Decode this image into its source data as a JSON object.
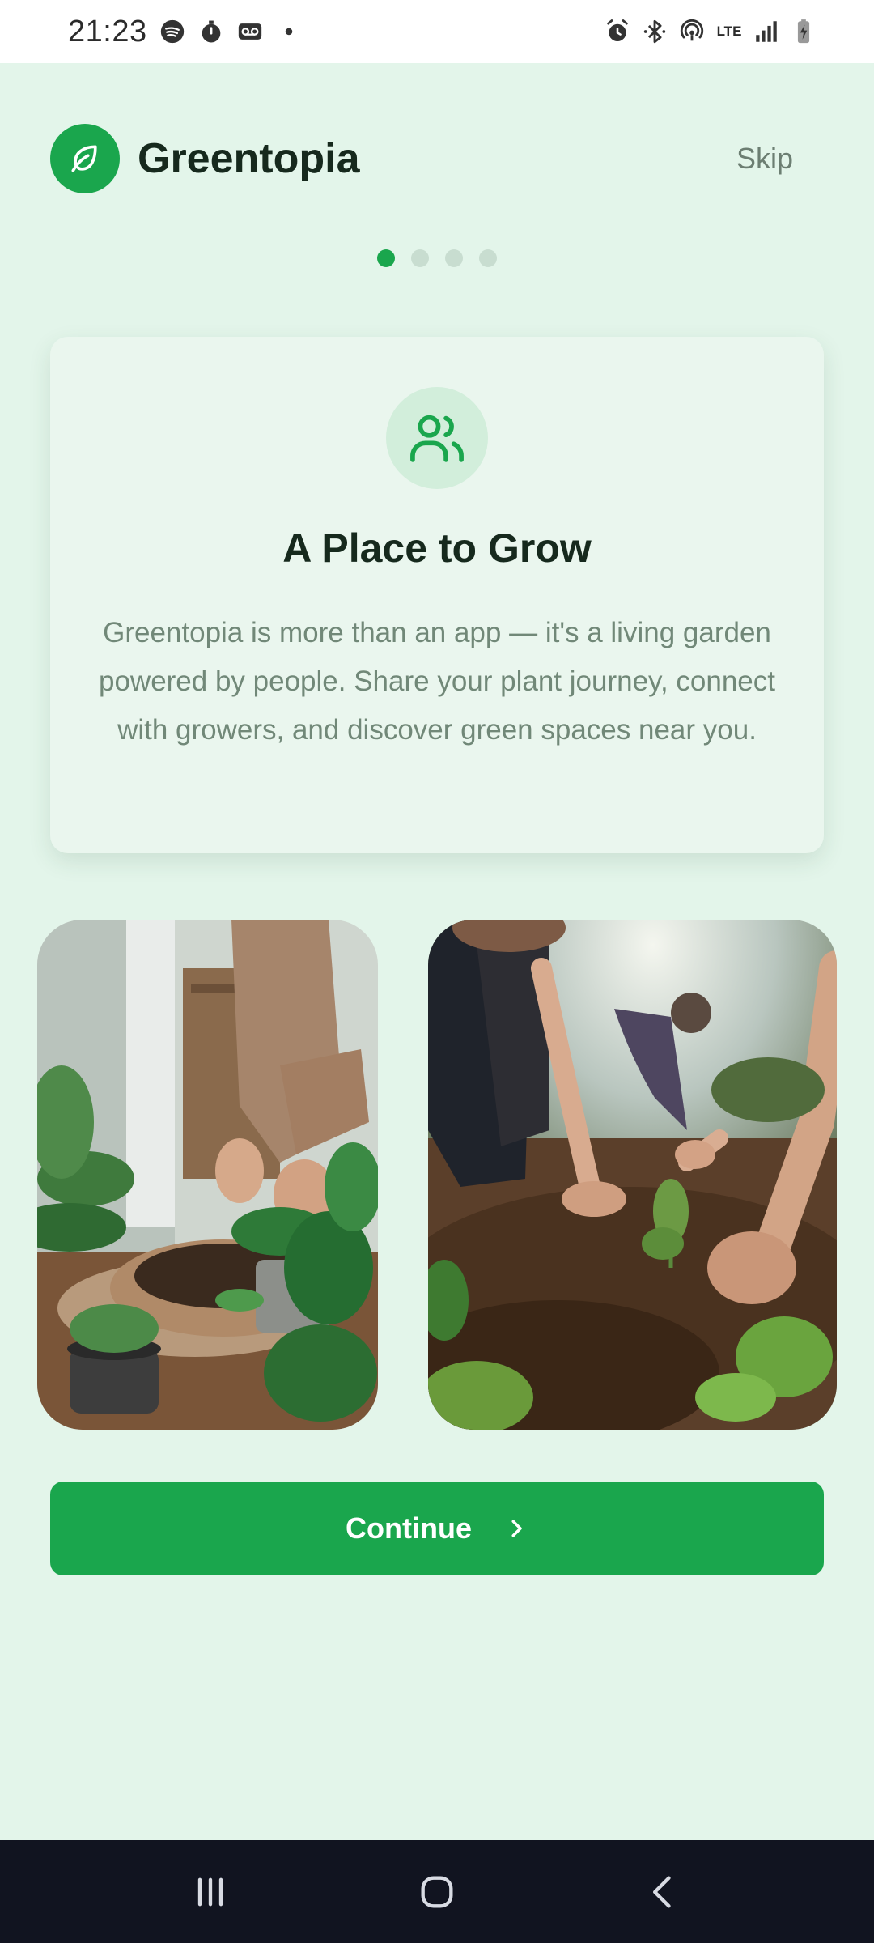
{
  "status_bar": {
    "time": "21:23",
    "left_icons": [
      "spotify-icon",
      "stopwatch-icon",
      "voicemail-icon",
      "dot-icon"
    ],
    "right_icons": [
      "alarm-icon",
      "bluetooth-icon",
      "hotspot-icon",
      "lte-icon",
      "signal-icon",
      "battery-icon"
    ],
    "lte_label": "LTE"
  },
  "header": {
    "app_name": "Greentopia",
    "skip_label": "Skip",
    "logo_icon": "leaf-icon"
  },
  "pager": {
    "total": 4,
    "active_index": 0
  },
  "card": {
    "icon": "users-icon",
    "title": "A Place to Grow",
    "body": "Greentopia is more than an app — it's a living garden powered by people. Share your plant journey, connect with growers, and discover green spaces near you."
  },
  "photos": [
    {
      "name": "indoor-potting-photo"
    },
    {
      "name": "community-garden-photo"
    }
  ],
  "actions": {
    "continue_label": "Continue",
    "continue_icon": "chevron-right-icon"
  },
  "nav_bar": {
    "buttons": [
      "recents-icon",
      "home-icon",
      "back-icon"
    ]
  },
  "colors": {
    "accent": "#1aa64d",
    "background": "#e3f5ea",
    "card": "#eaf6ee",
    "title_text": "#16291d",
    "muted_text": "#718878",
    "nav_bar": "#111420"
  }
}
